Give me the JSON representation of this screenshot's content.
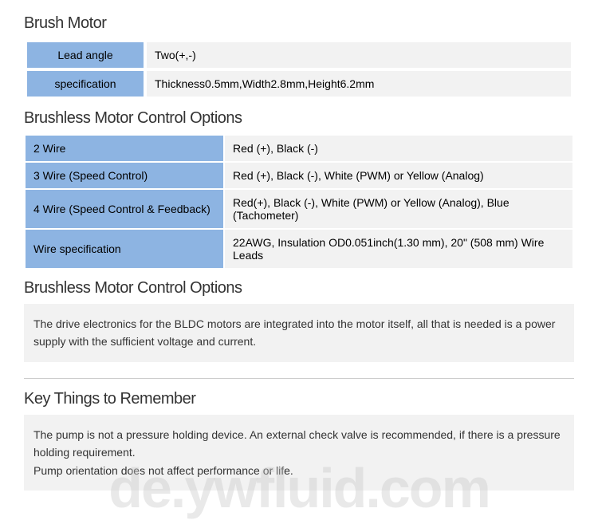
{
  "section1": {
    "title": "Brush Motor",
    "rows": [
      {
        "label": "Lead angle",
        "value": "Two(+,-)"
      },
      {
        "label": "specification",
        "value": "Thickness0.5mm,Width2.8mm,Height6.2mm"
      }
    ]
  },
  "section2": {
    "title": "Brushless Motor Control Options",
    "rows": [
      {
        "label": "2 Wire",
        "value": "Red (+), Black (-)"
      },
      {
        "label": "3 Wire (Speed Control)",
        "value": "Red (+), Black (-), White (PWM) or Yellow (Analog)"
      },
      {
        "label": "4 Wire (Speed Control & Feedback)",
        "value": "Red(+), Black (-), White (PWM) or Yellow (Analog), Blue (Tachometer)"
      },
      {
        "label": "Wire specification",
        "value": "22AWG, Insulation OD0.051inch(1.30 mm), 20\" (508 mm) Wire Leads"
      }
    ]
  },
  "section3": {
    "title": "Brushless Motor Control Options",
    "note": "The drive electronics for the BLDC motors are integrated into the motor itself, all that is needed is a power supply with the sufficient voltage and current."
  },
  "section4": {
    "title": "Key Things to Remember",
    "note": "The pump is not a pressure holding device. An external check valve is recommended, if there is a pressure holding requirement.\nPump orientation does not affect performance or life."
  },
  "watermark": "de.ywfluid.com"
}
